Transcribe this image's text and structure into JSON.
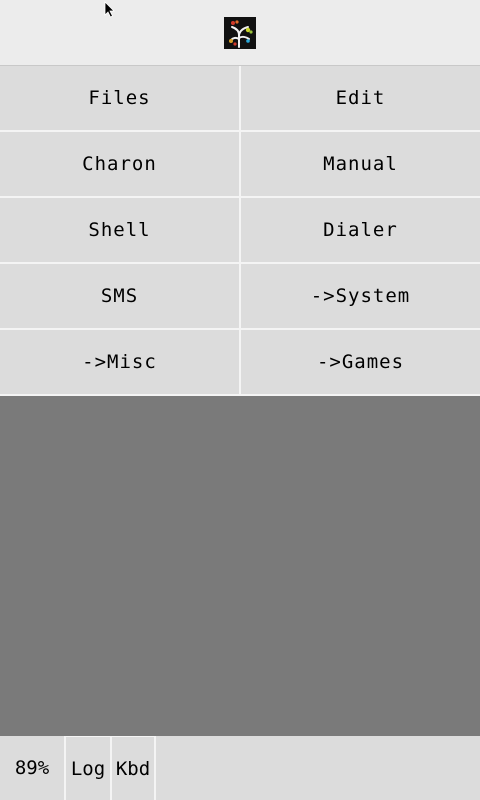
{
  "topbar": {
    "logo_icon": "tree-logo-icon",
    "cursor_icon": "mouse-pointer-icon"
  },
  "menu": {
    "items": [
      {
        "label": "Files"
      },
      {
        "label": "Edit"
      },
      {
        "label": "Charon"
      },
      {
        "label": "Manual"
      },
      {
        "label": "Shell"
      },
      {
        "label": "Dialer"
      },
      {
        "label": "SMS"
      },
      {
        "label": "->System"
      },
      {
        "label": "->Misc"
      },
      {
        "label": "->Games"
      }
    ]
  },
  "statusbar": {
    "battery": "89%",
    "log_label": "Log",
    "kbd_label": "Kbd"
  },
  "colors": {
    "background": "#7a7a7a",
    "button": "#dcdcdc",
    "topbar": "#ececec"
  }
}
